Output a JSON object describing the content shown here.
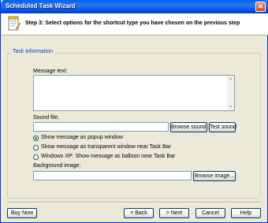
{
  "window": {
    "title": "Scheduled Task Wizard"
  },
  "header": {
    "step_text": "Step 3: Select options for the shortcut type you have chosen on the previous step"
  },
  "group": {
    "label": "Task information"
  },
  "message": {
    "label": "Message text:",
    "value": ""
  },
  "sound": {
    "label": "Sound file:",
    "value": "",
    "browse_label": "Browse sound...",
    "test_label": "Test sound"
  },
  "options": [
    {
      "label": "Show message as popup window",
      "selected": true
    },
    {
      "label": "Show message as transparent window near Task Bar",
      "selected": false
    },
    {
      "label": "Windows XP: Show message as balloon near Task Bar",
      "selected": false
    }
  ],
  "background": {
    "label": "Background image:",
    "value": "",
    "browse_label": "Browse image..."
  },
  "footer": {
    "buy_now": "Buy Now",
    "back": "< Back",
    "next": "> Next",
    "cancel": "Cancel",
    "help": "Help"
  },
  "icons": {
    "wizard": "wizard-notepad-icon",
    "close": "close-icon"
  },
  "colors": {
    "titlebar": "#0a5ee8",
    "group_label": "#0046d5",
    "selected_radio": "#21a121"
  }
}
